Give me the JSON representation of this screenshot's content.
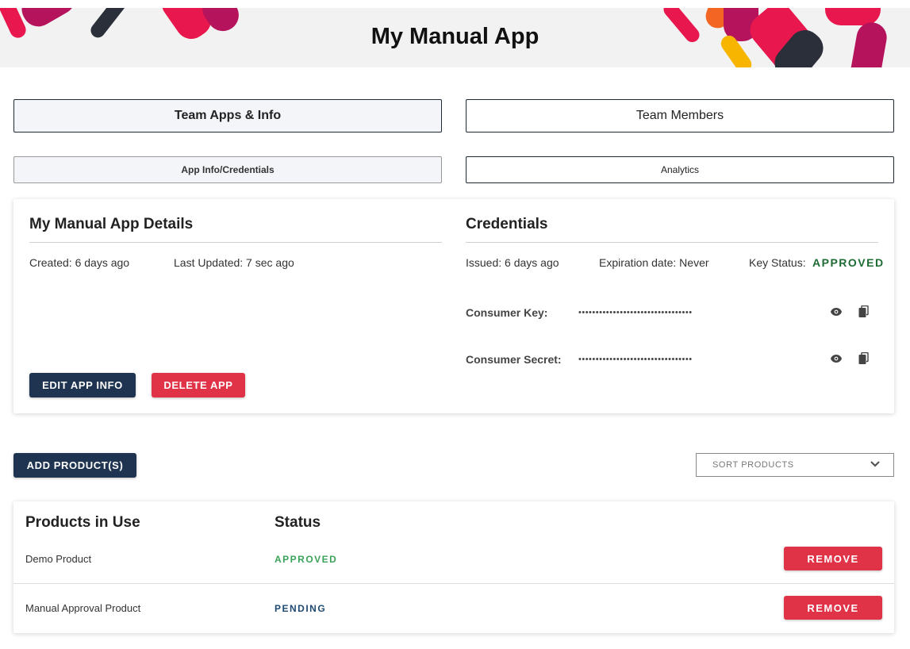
{
  "header": {
    "title": "My Manual App"
  },
  "tabs": {
    "main": [
      {
        "label": "Team Apps & Info",
        "active": true
      },
      {
        "label": "Team Members",
        "active": false
      }
    ],
    "sub": [
      {
        "label": "App Info/Credentials",
        "active": true
      },
      {
        "label": "Analytics",
        "active": false
      }
    ]
  },
  "details": {
    "title": "My Manual App Details",
    "created": "Created: 6 days ago",
    "last_updated": "Last Updated: 7 sec ago",
    "edit_label": "EDIT APP INFO",
    "delete_label": "DELETE APP"
  },
  "credentials": {
    "title": "Credentials",
    "issued": "Issued: 6 days ago",
    "expiration": "Expiration date: Never",
    "key_status_label": "Key Status:",
    "key_status_value": "APPROVED",
    "consumer_key_label": "Consumer Key:",
    "consumer_key_value": "•••••••••••••••••••••••••••••••••",
    "consumer_secret_label": "Consumer Secret:",
    "consumer_secret_value": "•••••••••••••••••••••••••••••••••",
    "icons": [
      "eye-icon",
      "copy-icon"
    ]
  },
  "products": {
    "add_label": "ADD PRODUCT(S)",
    "sort_placeholder": "SORT PRODUCTS",
    "header_product": "Products in Use",
    "header_status": "Status",
    "rows": [
      {
        "name": "Demo Product",
        "status": "APPROVED",
        "action": "REMOVE"
      },
      {
        "name": "Manual Approval Product",
        "status": "PENDING",
        "action": "REMOVE"
      }
    ]
  },
  "colors": {
    "navy": "#1e3450",
    "red": "#e03347",
    "approved_green": "#3aa35a",
    "approved_dark_green": "#1e6b34",
    "pending_blue": "#1e4a73"
  }
}
